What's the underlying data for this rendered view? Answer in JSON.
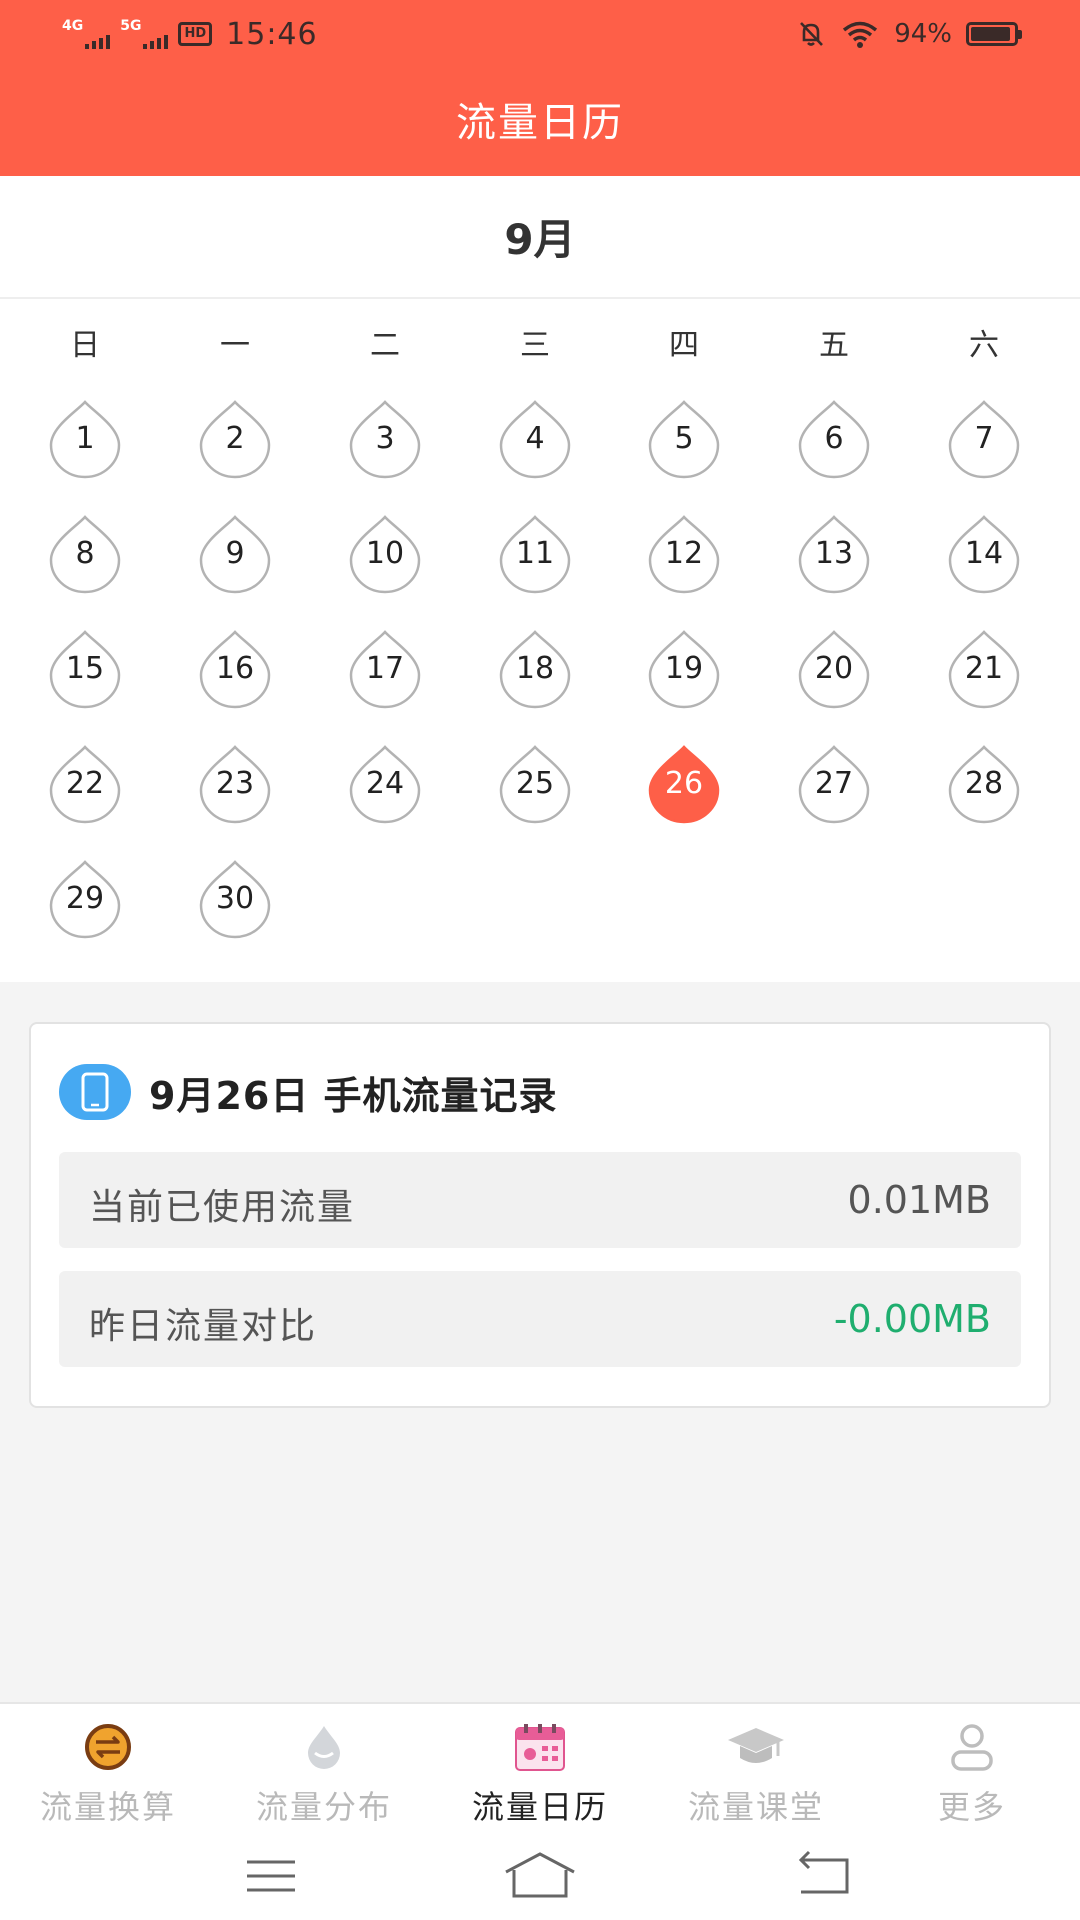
{
  "status_bar": {
    "network_1": "4G",
    "network_2": "5G",
    "hd_label": "HD",
    "time": "15:46",
    "battery_percent": "94%",
    "battery_level": 0.94,
    "icons": [
      "mute-bell-icon",
      "wifi-icon",
      "battery-icon"
    ]
  },
  "header": {
    "title": "流量日历"
  },
  "calendar": {
    "month_label": "9月",
    "weekdays": [
      "日",
      "一",
      "二",
      "三",
      "四",
      "五",
      "六"
    ],
    "days": [
      "1",
      "2",
      "3",
      "4",
      "5",
      "6",
      "7",
      "8",
      "9",
      "10",
      "11",
      "12",
      "13",
      "14",
      "15",
      "16",
      "17",
      "18",
      "19",
      "20",
      "21",
      "22",
      "23",
      "24",
      "25",
      "26",
      "27",
      "28",
      "29",
      "30"
    ],
    "first_weekday_index": 0,
    "selected_day": "26",
    "selected_color": "#fe5f48"
  },
  "record": {
    "title": "9月26日 手机流量记录",
    "icon": "phone-icon",
    "rows": [
      {
        "label": "当前已使用流量",
        "value": "0.01MB"
      },
      {
        "label": "昨日流量对比",
        "value": "-0.00MB",
        "value_color": "#1fae6f"
      }
    ]
  },
  "bottom_nav": {
    "items": [
      {
        "label": "流量换算",
        "icon": "exchange-icon",
        "active": false
      },
      {
        "label": "流量分布",
        "icon": "droplet-icon",
        "active": false
      },
      {
        "label": "流量日历",
        "icon": "calendar-icon",
        "active": true
      },
      {
        "label": "流量课堂",
        "icon": "graduation-cap-icon",
        "active": false
      },
      {
        "label": "更多",
        "icon": "user-icon",
        "active": false
      }
    ]
  },
  "system_nav": {
    "icons": [
      "menu-icon",
      "home-icon",
      "back-icon"
    ]
  },
  "colors": {
    "primary": "#fe5f48",
    "accent_blue": "#46a9f2",
    "positive_green": "#1fae6f"
  }
}
